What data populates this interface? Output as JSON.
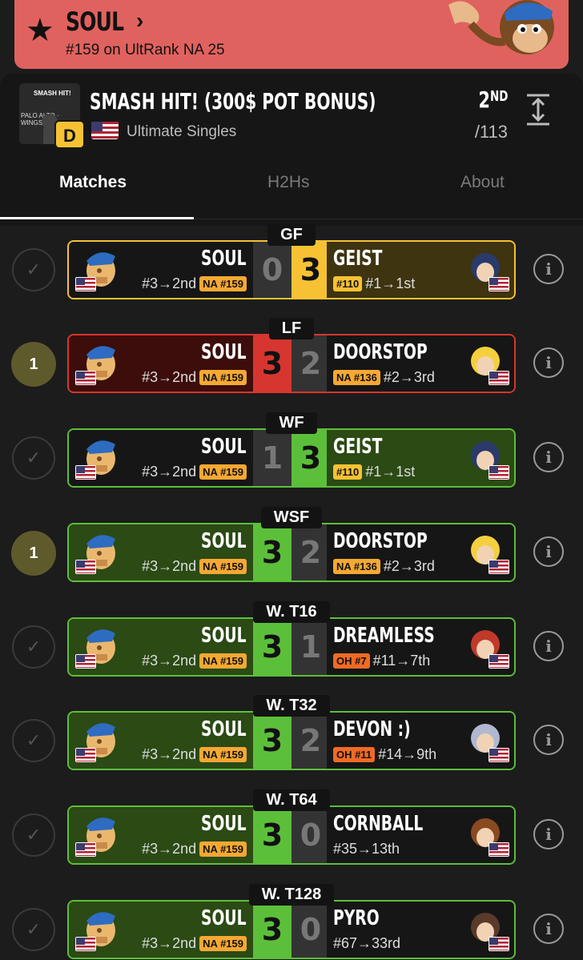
{
  "banner": {
    "player_name": "SOUL",
    "rank_line": "#159 on UltRank NA 25"
  },
  "tournament": {
    "title": "SMASH HIT! (300$ POT BONUS)",
    "thumb_text": "SMASH HIT!",
    "thumb_sub": "PALO ALTO · WINGS",
    "tier_badge": "D",
    "event": "Ultimate Singles",
    "placement": "2",
    "placement_suffix": "ND",
    "total": "/113"
  },
  "tabs": [
    {
      "label": "Matches",
      "active": true
    },
    {
      "label": "H2Hs",
      "active": false
    },
    {
      "label": "About",
      "active": false
    }
  ],
  "matches": [
    {
      "round": "GF",
      "status": "check",
      "left": {
        "name": "SOUL",
        "seed": "#3→2nd",
        "tag": "NA #159"
      },
      "lscore": "0",
      "rscore": "3",
      "right": {
        "name": "GEIST",
        "tag": "#110",
        "seed": "#1→1st"
      }
    },
    {
      "round": "LF",
      "status": "1",
      "left": {
        "name": "SOUL",
        "seed": "#3→2nd",
        "tag": "NA #159"
      },
      "lscore": "3",
      "rscore": "2",
      "right": {
        "name": "DOORSTOP",
        "tag": "NA #136",
        "seed": "#2→3rd"
      }
    },
    {
      "round": "WF",
      "status": "check",
      "left": {
        "name": "SOUL",
        "seed": "#3→2nd",
        "tag": "NA #159"
      },
      "lscore": "1",
      "rscore": "3",
      "right": {
        "name": "GEIST",
        "tag": "#110",
        "seed": "#1→1st"
      }
    },
    {
      "round": "WSF",
      "status": "1",
      "left": {
        "name": "SOUL",
        "seed": "#3→2nd",
        "tag": "NA #159"
      },
      "lscore": "3",
      "rscore": "2",
      "right": {
        "name": "DOORSTOP",
        "tag": "NA #136",
        "seed": "#2→3rd"
      }
    },
    {
      "round": "W. T16",
      "status": "check",
      "left": {
        "name": "SOUL",
        "seed": "#3→2nd",
        "tag": "NA #159"
      },
      "lscore": "3",
      "rscore": "1",
      "right": {
        "name": "DREAMLESS",
        "tag": "OH #7",
        "seed": "#11→7th"
      }
    },
    {
      "round": "W. T32",
      "status": "check",
      "left": {
        "name": "SOUL",
        "seed": "#3→2nd",
        "tag": "NA #159"
      },
      "lscore": "3",
      "rscore": "2",
      "right": {
        "name": "DEVON :)",
        "tag": "OH #11",
        "seed": "#14→9th"
      }
    },
    {
      "round": "W. T64",
      "status": "check",
      "left": {
        "name": "SOUL",
        "seed": "#3→2nd",
        "tag": "NA #159"
      },
      "lscore": "3",
      "rscore": "0",
      "right": {
        "name": "CORNBALL",
        "tag": "",
        "seed": "#35→13th"
      }
    },
    {
      "round": "W. T128",
      "status": "check",
      "left": {
        "name": "SOUL",
        "seed": "#3→2nd",
        "tag": "NA #159"
      },
      "lscore": "3",
      "rscore": "0",
      "right": {
        "name": "PYRO",
        "tag": "",
        "seed": "#67→33rd"
      }
    }
  ],
  "colors": {
    "win_green": "#5cbf3a",
    "loss_red": "#d6362f",
    "gold": "#f6c233",
    "banner": "#e0625e"
  }
}
